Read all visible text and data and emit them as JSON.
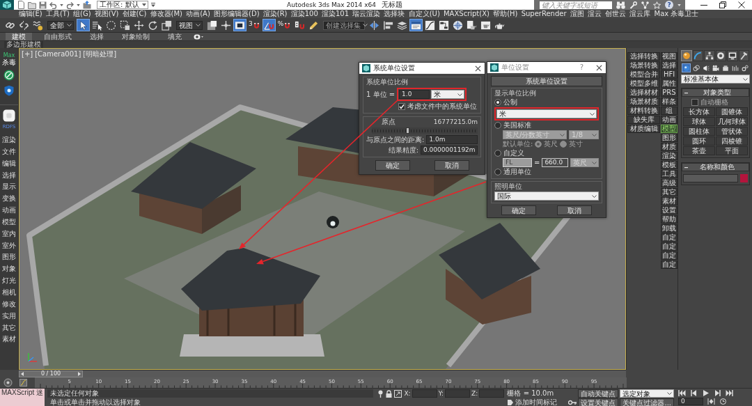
{
  "title_bar": {
    "workspace": "工作区: 默认",
    "app_title": "Autodesk 3ds Max 2014 x64",
    "document_title": "无标题",
    "search": {
      "placeholder": "键入关键字或短语"
    },
    "help": "?"
  },
  "menu_bar": [
    "编辑(E)",
    "工具(T)",
    "组(G)",
    "视图(V)",
    "创建(C)",
    "修改器(M)",
    "动画(A)",
    "图形编辑器(D)",
    "渲染(R)",
    "渲染100",
    "渲染101",
    "瑞云渲染",
    "选择块",
    "自定义(U)",
    "MAXScript(X)",
    "帮助(H)",
    "SuperRender",
    "渲图",
    "渲云",
    "创世云",
    "渲云库",
    "Max 杀毒卫士"
  ],
  "toolbar": [
    {
      "kind": "button",
      "pressed": false
    },
    {
      "kind": "button",
      "pressed": false
    },
    {
      "kind": "button",
      "pressed": false
    },
    {
      "kind": "dropdown",
      "value": "全部"
    },
    {
      "kind": "button",
      "pressed": true
    },
    {
      "kind": "button",
      "pressed": false
    },
    {
      "kind": "button",
      "pressed": false
    },
    {
      "kind": "button",
      "pressed": false
    },
    {
      "kind": "button",
      "pressed": false
    },
    {
      "kind": "button",
      "pressed": false
    },
    {
      "kind": "button",
      "pressed": false
    },
    {
      "kind": "dropdown",
      "value": "视图"
    },
    {
      "kind": "button",
      "pressed": false
    },
    {
      "kind": "button",
      "pressed": false
    },
    {
      "kind": "button",
      "pressed": true
    },
    {
      "kind": "button",
      "label": "3",
      "pressed": false
    },
    {
      "kind": "button",
      "pressed": true
    },
    {
      "kind": "button",
      "label": "%",
      "pressed": false
    },
    {
      "kind": "button",
      "pressed": false
    },
    {
      "kind": "button",
      "pressed": false
    },
    {
      "kind": "dropdown",
      "value": "创建选择集"
    },
    {
      "kind": "button",
      "pressed": false
    },
    {
      "kind": "button",
      "pressed": false
    },
    {
      "kind": "button",
      "pressed": false
    },
    {
      "kind": "button",
      "pressed": true
    },
    {
      "kind": "button",
      "pressed": false
    },
    {
      "kind": "button",
      "pressed": false
    },
    {
      "kind": "button",
      "pressed": false
    },
    {
      "kind": "button",
      "pressed": false
    },
    {
      "kind": "button",
      "pressed": false
    },
    {
      "kind": "button",
      "pressed": false
    }
  ],
  "ribbon": {
    "tabs": [
      {
        "label": "建模",
        "selected": true
      },
      {
        "label": "自由形式",
        "selected": false
      },
      {
        "label": "选择",
        "selected": false
      },
      {
        "label": "对象绘制",
        "selected": false
      },
      {
        "label": "填充",
        "selected": false
      }
    ],
    "panel": "多边形建模"
  },
  "left_toolbar": {
    "label_lines": [
      "Max",
      "杀毒"
    ],
    "tag": "RDFS",
    "items": [
      "渲染",
      "文件",
      "编辑",
      "选择",
      "显示",
      "变换",
      "动画",
      "模型",
      "室内",
      "室外",
      "图形",
      "对象",
      "灯光",
      "相机",
      "修改",
      "实用",
      "其它",
      "素材"
    ]
  },
  "viewport": {
    "labels": [
      "[+]",
      "[Camera001]",
      "[明暗处理]"
    ]
  },
  "system_units_dialog": {
    "title": "系统单位设置",
    "scale_group": "系统单位比例",
    "unit_label": "1 单位 =",
    "unit_value": "1.0",
    "unit": "米",
    "highlighted": true,
    "respect_units": {
      "label": "考虑文件中的系统单位",
      "checked": true
    },
    "origin_label": "原点",
    "origin_value": "16777215.0m",
    "origin_slider": {
      "level": 0.33
    },
    "distance_label": "与原点之间的距离:",
    "distance_value": "1.0m",
    "precision_label": "结果精度:",
    "precision_value": "0.0000001192m",
    "buttons": [
      "确定",
      "取消"
    ]
  },
  "units_setup_dialog": {
    "title": "单位设置",
    "help": "?",
    "system_units_button": "系统单位设置",
    "display_group": "显示单位比例",
    "metric": {
      "label": "公制",
      "selected": true,
      "unit": "米",
      "highlighted": true
    },
    "us_standard": {
      "label": "美国标准",
      "selected": false,
      "unit": "英尺/分数英寸",
      "fraction": "1/8",
      "default_label": "默认单位:",
      "default_units": [
        {
          "label": "英尺",
          "selected": true
        },
        {
          "label": "英寸",
          "selected": false
        }
      ]
    },
    "custom": {
      "label": "自定义",
      "selected": false,
      "name": "FL",
      "equals": "=",
      "value": "660.0",
      "unit": "英尺"
    },
    "generic": {
      "label": "通用单位",
      "selected": false
    },
    "lighting_group": "照明单位",
    "lighting_unit": "国际",
    "buttons": [
      "确定",
      "取消"
    ]
  },
  "right_toolbar": {
    "column_1": [
      "选择转换",
      "场景转换",
      "模型合并",
      "模型多维",
      "选择材材",
      "场景材质",
      "材料转换",
      "缺失库",
      "材质编辑"
    ],
    "column_2": [
      {
        "label": "视图",
        "selected": false
      },
      {
        "label": "选择",
        "selected": false
      },
      {
        "label": "HFI",
        "selected": false
      },
      {
        "label": "属性",
        "selected": false
      },
      {
        "label": "PRS",
        "selected": false
      },
      {
        "label": "样条",
        "selected": false
      },
      {
        "label": "组",
        "selected": false
      },
      {
        "label": "动画",
        "selected": false
      },
      {
        "label": "模型",
        "selected": true
      },
      {
        "label": "图形",
        "selected": false
      },
      {
        "label": "材质",
        "selected": false
      },
      {
        "label": "渲染",
        "selected": false
      },
      {
        "label": "模板",
        "selected": false
      },
      {
        "label": "工具",
        "selected": false
      },
      {
        "label": "高级",
        "selected": false
      },
      {
        "label": "其它",
        "selected": false
      },
      {
        "label": "素材",
        "selected": false
      },
      {
        "label": "设置",
        "selected": false
      },
      {
        "label": "帮助",
        "selected": false
      },
      {
        "label": "卸载",
        "selected": false
      },
      {
        "label": "自定",
        "selected": false
      },
      {
        "label": "自定",
        "selected": false
      },
      {
        "label": "自定",
        "selected": false
      },
      {
        "label": "自定",
        "selected": false
      }
    ]
  },
  "command_panel": {
    "tabs": [
      {
        "selected": true
      },
      {
        "selected": false
      },
      {
        "selected": false
      },
      {
        "selected": false
      },
      {
        "selected": false
      },
      {
        "selected": false
      }
    ],
    "categories": [
      {
        "selected": true
      },
      {
        "selected": false
      },
      {
        "selected": false
      },
      {
        "selected": false
      },
      {
        "selected": false
      },
      {
        "selected": false
      },
      {
        "selected": false
      }
    ],
    "dropdown": "标准基本体",
    "object_type": {
      "title": "对象类型",
      "autogrid": {
        "label": "自动栅格",
        "checked": false
      },
      "buttons": [
        "长方体",
        "圆锥体",
        "球体",
        "几何球体",
        "圆柱体",
        "管状体",
        "圆环",
        "四棱锥",
        "茶壶",
        "平面"
      ]
    },
    "name_and_color": {
      "title": "名称和颜色",
      "color": "#b3143c"
    }
  },
  "time_slider": {
    "label": "0 / 100",
    "level": 0
  },
  "track_bar": {
    "labels": [
      "5",
      "10",
      "15",
      "20",
      "25",
      "30",
      "35",
      "40",
      "45",
      "50",
      "55",
      "60",
      "65",
      "70",
      "75",
      "80",
      "85",
      "90",
      "95"
    ]
  },
  "status_bar": {
    "listener": "MAXScript 迷",
    "prompt": "未选定任何对象",
    "hint": "单击或单击并拖动以选择对象",
    "coordinates": [
      "X:",
      "Y:",
      "Z:"
    ],
    "grid": "栅格 = 10.0m",
    "time_tag": "添加时间标记",
    "auto_key": "自动关键点",
    "key_target": "选定对象",
    "set_key": "设置关键点",
    "key_filters": "关键点过滤器...",
    "frame": "0"
  }
}
